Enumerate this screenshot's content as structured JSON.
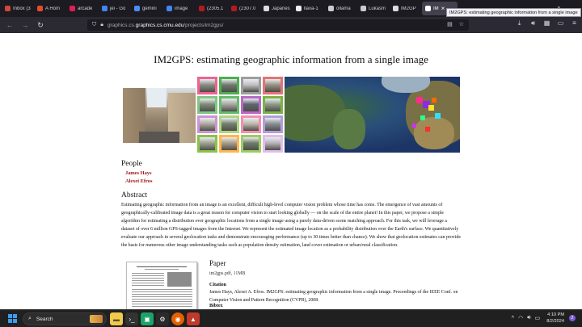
{
  "browser": {
    "tabs": [
      {
        "label": "Inbox (3",
        "color": "#d44638"
      },
      {
        "label": "A Hom",
        "color": "#e34c26"
      },
      {
        "label": "arcade",
        "color": "#e01e5a"
      },
      {
        "label": "jei - Go",
        "color": "#4285f4"
      },
      {
        "label": "gemini",
        "color": "#4c8bf5"
      },
      {
        "label": "image",
        "color": "#4285f4"
      },
      {
        "label": "(2305.1",
        "color": "#b31b1b"
      },
      {
        "label": "(2307.0",
        "color": "#b31b1b"
      },
      {
        "label": "Japanes",
        "color": "#dddddd"
      },
      {
        "label": "llava-1",
        "color": "#eeeeee"
      },
      {
        "label": "ollama",
        "color": "#cccccc"
      },
      {
        "label": "Lukasm",
        "color": "#cccccc"
      },
      {
        "label": "IM2GP",
        "color": "#dddddd"
      },
      {
        "label": "IM",
        "color": "#ffffff"
      }
    ],
    "tooltip": "IM2GPS: estimating geographic information from a single image",
    "url_domain": "graphics.cs.cmu.edu",
    "url_path": "/projects/im2gps/"
  },
  "page": {
    "title": "IM2GPS: estimating geographic information from a single image",
    "people_heading": "People",
    "authors": [
      "James Hays",
      "Alexei Efros"
    ],
    "abstract_heading": "Abstract",
    "abstract": "Estimating geographic information from an image is an excellent, difficult high-level computer vision problem whose time has come. The emergence of vast amounts of geographically-calibrated image data is a great reason for computer vision to start looking globally — on the scale of the entire planet! In this paper, we propose a simple algorithm for estimating a distribution over geographic locations from a single image using a purely data-driven scene matching approach. For this task, we will leverage a dataset of over 6 million GPS-tagged images from the Internet. We represent the estimated image location as a probability distribution over the Earth's surface. We quantitatively evaluate our approach in several geolocation tasks and demonstrate encouraging performance (up to 30 times better than chance). We show that geolocation estimates can provide the basis for numerous other image understanding tasks such as population density estimation, land cover estimation or urban/rural classification.",
    "paper_heading": "Paper",
    "paper_file": "im2gps.pdf, 11MB",
    "citation_heading": "Citation",
    "citation": "James Hays, Alexei A. Efros. IM2GPS: estimating geographic information from a single image. Proceedings of the IEEE Conf. on Computer Vision and Pattern Recognition (CVPR), 2008.",
    "bibtex_label": "Bibtex"
  },
  "taskbar": {
    "search_label": "Search",
    "time": "4:10 PM",
    "date": "8/2/2024",
    "notifications": "2"
  }
}
